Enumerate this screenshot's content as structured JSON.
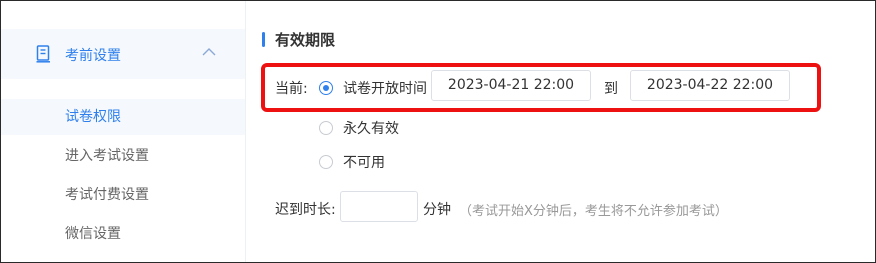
{
  "sidebar": {
    "group": {
      "label": "考前设置",
      "icon": "document-icon",
      "expanded": true
    },
    "items": [
      {
        "label": "试卷权限",
        "active": true
      },
      {
        "label": "进入考试设置",
        "active": false
      },
      {
        "label": "考试付费设置",
        "active": false
      },
      {
        "label": "微信设置",
        "active": false
      }
    ]
  },
  "section": {
    "title": "有效期限",
    "current_label": "当前:",
    "options": [
      {
        "label": "试卷开放时间",
        "selected": true
      },
      {
        "label": "永久有效",
        "selected": false
      },
      {
        "label": "不可用",
        "selected": false
      }
    ],
    "start_time": "2023-04-21 22:00",
    "to_label": "到",
    "end_time": "2023-04-22 22:00",
    "late_label": "迟到时长:",
    "late_value": "",
    "minutes_label": "分钟",
    "late_hint": "（考试开始X分钟后，考生将不允许参加考试）"
  },
  "colors": {
    "accent": "#2f80ed",
    "highlight": "#ee1111"
  }
}
